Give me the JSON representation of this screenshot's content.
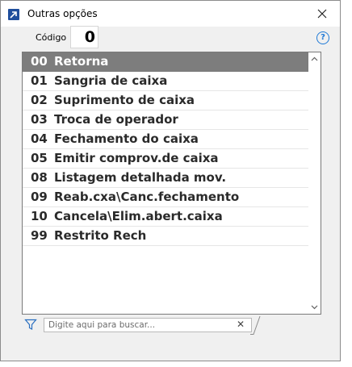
{
  "window": {
    "title": "Outras opções"
  },
  "codigo": {
    "label": "Código",
    "value": "0"
  },
  "list": {
    "items": [
      {
        "code": "00",
        "label": "Retorna",
        "selected": true
      },
      {
        "code": "01",
        "label": "Sangria de caixa"
      },
      {
        "code": "02",
        "label": "Suprimento de caixa"
      },
      {
        "code": "03",
        "label": "Troca de operador"
      },
      {
        "code": "04",
        "label": "Fechamento do caixa"
      },
      {
        "code": "05",
        "label": "Emitir comprov.de caixa"
      },
      {
        "code": "08",
        "label": "Listagem detalhada mov."
      },
      {
        "code": "09",
        "label": "Reab.cxa\\Canc.fechamento"
      },
      {
        "code": "10",
        "label": "Cancela\\Elim.abert.caixa"
      },
      {
        "code": "99",
        "label": "Restrito Rech"
      }
    ]
  },
  "search": {
    "placeholder": "Digite aqui para buscar..."
  },
  "colors": {
    "accent": "#1f7ad6",
    "selected_row": "#7d7d7d"
  },
  "icons": [
    "app-icon",
    "close-icon",
    "help-icon",
    "filter-icon",
    "clear-icon",
    "chevron-up-icon",
    "chevron-down-icon"
  ]
}
